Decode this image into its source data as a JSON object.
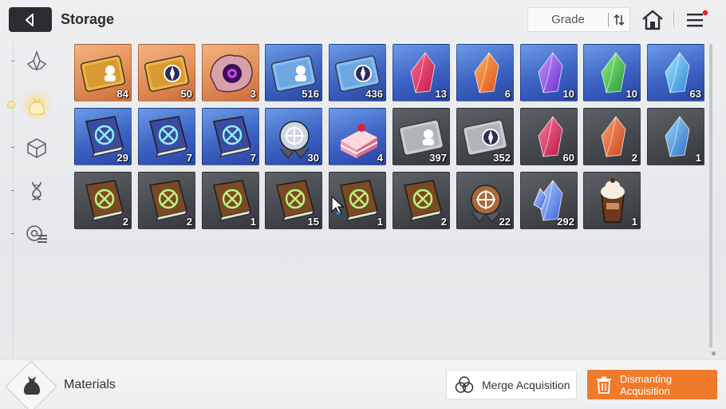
{
  "header": {
    "title": "Storage",
    "sort": {
      "label": "Grade"
    }
  },
  "nav": {
    "items": [
      {
        "name": "crystal",
        "icon": "crystal-icon",
        "active": false
      },
      {
        "name": "materials",
        "icon": "pouch-icon",
        "active": true
      },
      {
        "name": "cube",
        "icon": "cube-icon",
        "active": false
      },
      {
        "name": "dna",
        "icon": "dna-icon",
        "active": false
      },
      {
        "name": "gear-list",
        "icon": "gear-list-icon",
        "active": false
      }
    ]
  },
  "items": [
    {
      "name": "gold-ticket-bust",
      "grade": "orange",
      "qty": "84"
    },
    {
      "name": "gold-ticket-compass",
      "grade": "orange",
      "qty": "50"
    },
    {
      "name": "purple-eye-ore",
      "grade": "orange",
      "qty": "3"
    },
    {
      "name": "blue-ticket-bust",
      "grade": "blue",
      "qty": "516"
    },
    {
      "name": "blue-ticket-compass",
      "grade": "blue",
      "qty": "436"
    },
    {
      "name": "red-crystal",
      "grade": "blue",
      "qty": "13"
    },
    {
      "name": "orange-crystal",
      "grade": "blue",
      "qty": "6"
    },
    {
      "name": "purple-crystal",
      "grade": "blue",
      "qty": "10"
    },
    {
      "name": "green-crystal",
      "grade": "blue",
      "qty": "10"
    },
    {
      "name": "cyan-crystal",
      "grade": "blue",
      "qty": "63"
    },
    {
      "name": "blue-book-swords",
      "grade": "blue",
      "qty": "29"
    },
    {
      "name": "blue-book-shield",
      "grade": "blue",
      "qty": "7"
    },
    {
      "name": "blue-book-slash",
      "grade": "blue",
      "qty": "7"
    },
    {
      "name": "silver-medal",
      "grade": "blue",
      "qty": "30"
    },
    {
      "name": "cake",
      "grade": "blue",
      "qty": "4"
    },
    {
      "name": "gray-ticket-bust",
      "grade": "gray",
      "qty": "397"
    },
    {
      "name": "gray-ticket-compass",
      "grade": "gray",
      "qty": "352"
    },
    {
      "name": "dim-red-crystal",
      "grade": "gray",
      "qty": "60"
    },
    {
      "name": "dim-orange-crystal",
      "grade": "gray",
      "qty": "2"
    },
    {
      "name": "dim-cyan-crystal",
      "grade": "gray",
      "qty": "1"
    },
    {
      "name": "brown-book-swords",
      "grade": "gray",
      "qty": "2"
    },
    {
      "name": "brown-book-shield",
      "grade": "gray",
      "qty": "2"
    },
    {
      "name": "brown-book-eye",
      "grade": "gray",
      "qty": "1"
    },
    {
      "name": "brown-book-wing",
      "grade": "gray",
      "qty": "15"
    },
    {
      "name": "brown-book-slash",
      "grade": "gray",
      "qty": "1"
    },
    {
      "name": "brown-book-globe",
      "grade": "gray",
      "qty": "2"
    },
    {
      "name": "bronze-medal",
      "grade": "gray",
      "qty": "22"
    },
    {
      "name": "blue-crystal-cluster",
      "grade": "gray",
      "qty": "292"
    },
    {
      "name": "chocolate-drink",
      "grade": "gray",
      "qty": "1"
    }
  ],
  "footer": {
    "category": "Materials",
    "merge_label": "Merge Acquisition",
    "dismantle_label": "Dismanting Acquisition"
  },
  "colors": {
    "accent_orange": "#f07a2b",
    "grade_orange": "#e38d57",
    "grade_blue": "#3c62c4",
    "grade_gray": "#44474c",
    "notification_red": "#e6232a"
  }
}
